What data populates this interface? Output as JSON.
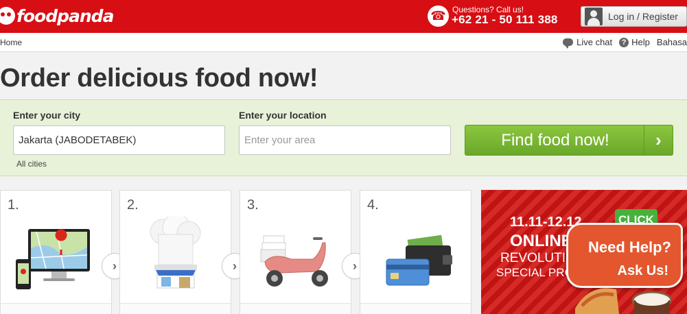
{
  "brand": {
    "name": "foodpanda"
  },
  "header": {
    "questions_label": "Questions? Call us!",
    "phone_number": "+62 21 - 50 111 388",
    "login_label": "Log in / Register"
  },
  "nav": {
    "home": "Home",
    "live_chat": "Live chat",
    "help": "Help",
    "language": "Bahasa"
  },
  "headline": "Order delicious food now!",
  "search": {
    "city_label": "Enter your city",
    "city_value": "Jakarta (JABODETABEK)",
    "location_label": "Enter your location",
    "location_placeholder": "Enter your area",
    "all_cities": "All cities",
    "find_button": "Find food now!"
  },
  "steps": [
    {
      "number": "1.",
      "icon": "devices-map-icon"
    },
    {
      "number": "2.",
      "icon": "chef-restaurant-icon"
    },
    {
      "number": "3.",
      "icon": "delivery-scooter-icon"
    },
    {
      "number": "4.",
      "icon": "wallet-card-icon"
    }
  ],
  "promo": {
    "line1": "11.11-12.12",
    "line2": "ONLINE",
    "line3": "REVOLUTION",
    "line4": "SPECIAL PRO",
    "click": "CLICK"
  },
  "help_widget": {
    "line1": "Need Help?",
    "line2": "Ask Us!"
  },
  "colors": {
    "brand_red": "#d70f14",
    "cta_green": "#7ab834",
    "panel_green": "#e8f2d9"
  }
}
